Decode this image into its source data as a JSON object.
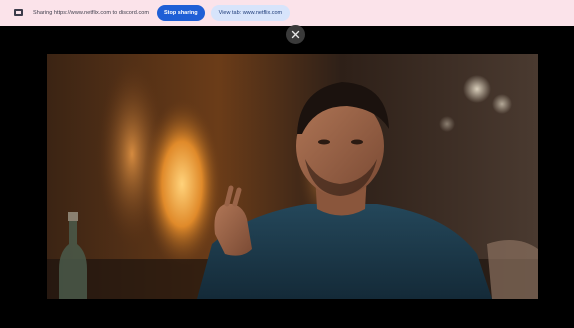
{
  "share_bar": {
    "sharing_text": "Sharing https://www.netflix.com to discord.com",
    "stop_label": "Stop sharing",
    "view_tab_label": "View tab: www.netflix.com"
  },
  "icons": {
    "share": "screen-share-icon",
    "close": "close-icon"
  },
  "colors": {
    "share_bar_bg": "#fbe3ea",
    "stop_button": "#1f5fd6",
    "view_button": "#d7e4fb"
  }
}
